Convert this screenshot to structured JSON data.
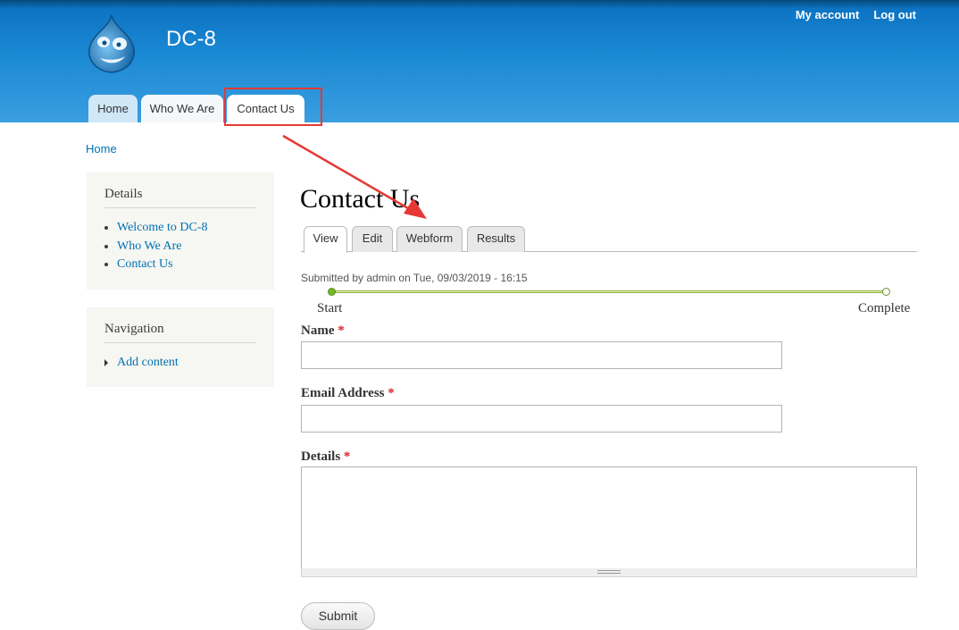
{
  "site": {
    "name": "DC-8"
  },
  "secondary_menu": {
    "my_account": "My account",
    "log_out": "Log out"
  },
  "main_menu": {
    "home": "Home",
    "who_we_are": "Who We Are",
    "contact_us": "Contact Us"
  },
  "breadcrumb": {
    "home": "Home"
  },
  "sidebar": {
    "details": {
      "title": "Details",
      "items": [
        "Welcome to DC-8",
        "Who We Are",
        "Contact Us"
      ]
    },
    "navigation": {
      "title": "Navigation",
      "items": [
        "Add content"
      ]
    }
  },
  "page": {
    "title": "Contact Us",
    "tabs": [
      "View",
      "Edit",
      "Webform",
      "Results"
    ],
    "active_tab": "View",
    "submitted": "Submitted by admin on Tue, 09/03/2019 - 16:15"
  },
  "progress": {
    "start": "Start",
    "end": "Complete",
    "current_step": 1,
    "total_steps": 2
  },
  "form": {
    "name_label": "Name",
    "email_label": "Email Address",
    "details_label": "Details",
    "required_marker": "*",
    "name_value": "",
    "email_value": "",
    "details_value": "",
    "submit_label": "Submit"
  },
  "colors": {
    "header": "#1b89d4",
    "link": "#0071b3",
    "annotation": "#e53935",
    "progress": "#76b82a"
  }
}
